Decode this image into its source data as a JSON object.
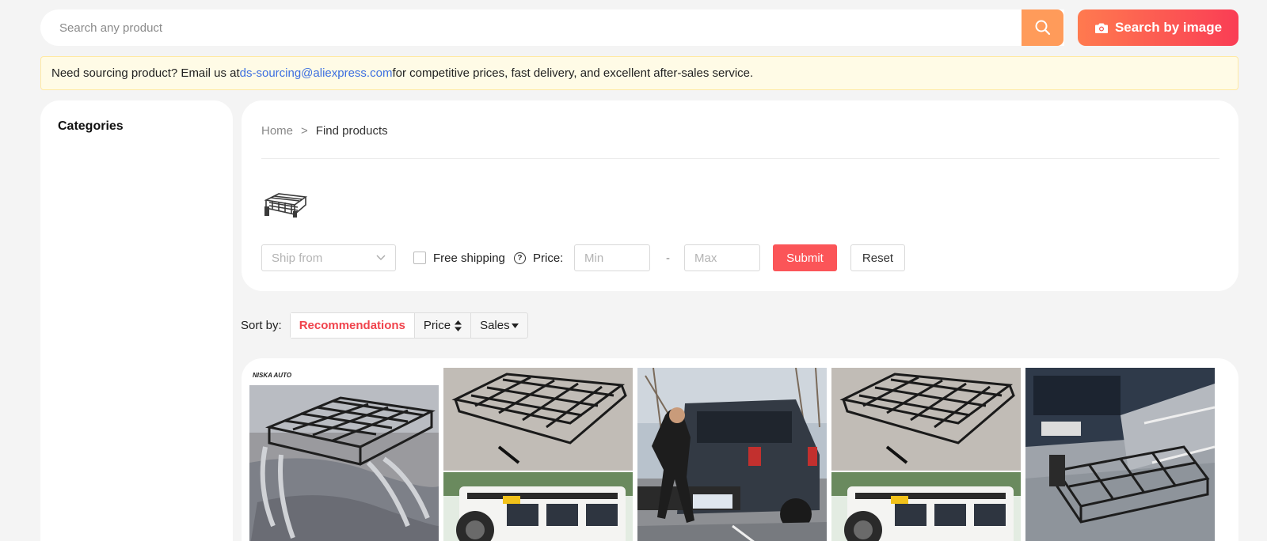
{
  "search": {
    "placeholder": "Search any product",
    "image_button_label": "Search by image"
  },
  "notice": {
    "prefix": "Need sourcing product? Email us at ",
    "email": "ds-sourcing@aliexpress.com",
    "suffix": " for competitive prices, fast delivery, and excellent after-sales service."
  },
  "sidebar": {
    "title": "Categories"
  },
  "breadcrumb": {
    "home": "Home",
    "separator": ">",
    "current": "Find products"
  },
  "filters": {
    "ship_from_placeholder": "Ship from",
    "free_shipping_label": "Free shipping",
    "price_label": "Price:",
    "min_placeholder": "Min",
    "max_placeholder": "Max",
    "dash": "-",
    "submit_label": "Submit",
    "reset_label": "Reset"
  },
  "sort": {
    "label": "Sort by:",
    "options": [
      "Recommendations",
      "Price",
      "Sales"
    ]
  },
  "products": {
    "brand_text": "NISKA AUTO"
  },
  "colors": {
    "accent": "#fb5558",
    "search_button": "#ff9b5a",
    "link": "#3d6fe0"
  }
}
